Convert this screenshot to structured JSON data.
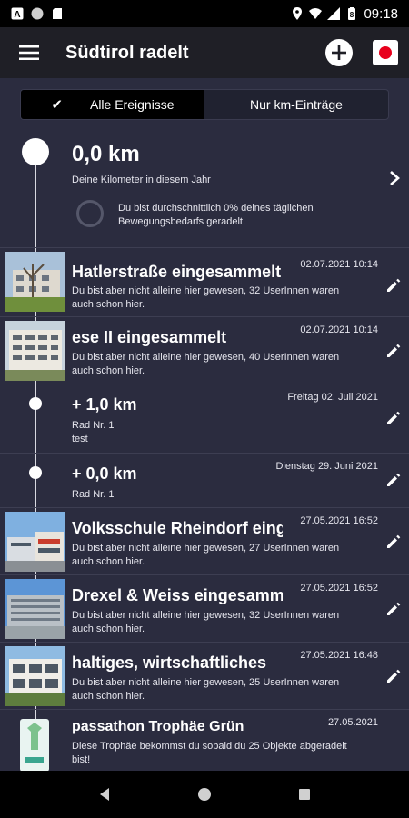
{
  "status_bar": {
    "time": "09:18"
  },
  "app_bar": {
    "title": "Südtirol radelt"
  },
  "filter": {
    "all_label": "Alle Ereignisse",
    "km_label": "Nur km-Einträge"
  },
  "summary": {
    "km": "0,0 km",
    "subtitle": "Deine Kilometer in diesem Jahr",
    "progress_text": "Du bist durchschnittlich 0% deines täglichen Bewegungsbedarfs geradelt.",
    "progress_fraction": 0.0
  },
  "entries": [
    {
      "title": "Hatlerstraße eingesammelt",
      "date": "02.07.2021 10:14",
      "desc": "Du bist aber nicht alleine hier gewesen, 32 UserInnen waren auch schon hier."
    },
    {
      "title": "ese II eingesammelt",
      "date": "02.07.2021 10:14",
      "desc": "Du bist aber nicht alleine hier gewesen, 40 UserInnen waren auch schon hier."
    },
    {
      "title": "+ 1,0 km",
      "date": "Freitag 02. Juli 2021",
      "line1": "Rad Nr. 1",
      "line2": "test"
    },
    {
      "title": "+ 0,0 km",
      "date": "Dienstag 29. Juni 2021",
      "line1": "Rad Nr. 1"
    },
    {
      "title": "Volksschule Rheindorf eingesammelt",
      "date": "27.05.2021 16:52",
      "desc": "Du bist aber nicht alleine hier gewesen, 27 UserInnen waren auch schon hier."
    },
    {
      "title": "Drexel & Weiss eingesammelt",
      "date": "27.05.2021 16:52",
      "desc": "Du bist aber nicht alleine hier gewesen, 32 UserInnen waren auch schon hier."
    },
    {
      "title": "haltiges, wirtschaftliches",
      "date": "27.05.2021 16:48",
      "desc": "Du bist aber nicht alleine hier gewesen, 25 UserInnen waren auch schon hier."
    },
    {
      "title": "passathon Trophäe Grün",
      "date": "27.05.2021",
      "desc": "Diese Trophäe bekommst du sobald du 25 Objekte abgeradelt bist!"
    }
  ]
}
